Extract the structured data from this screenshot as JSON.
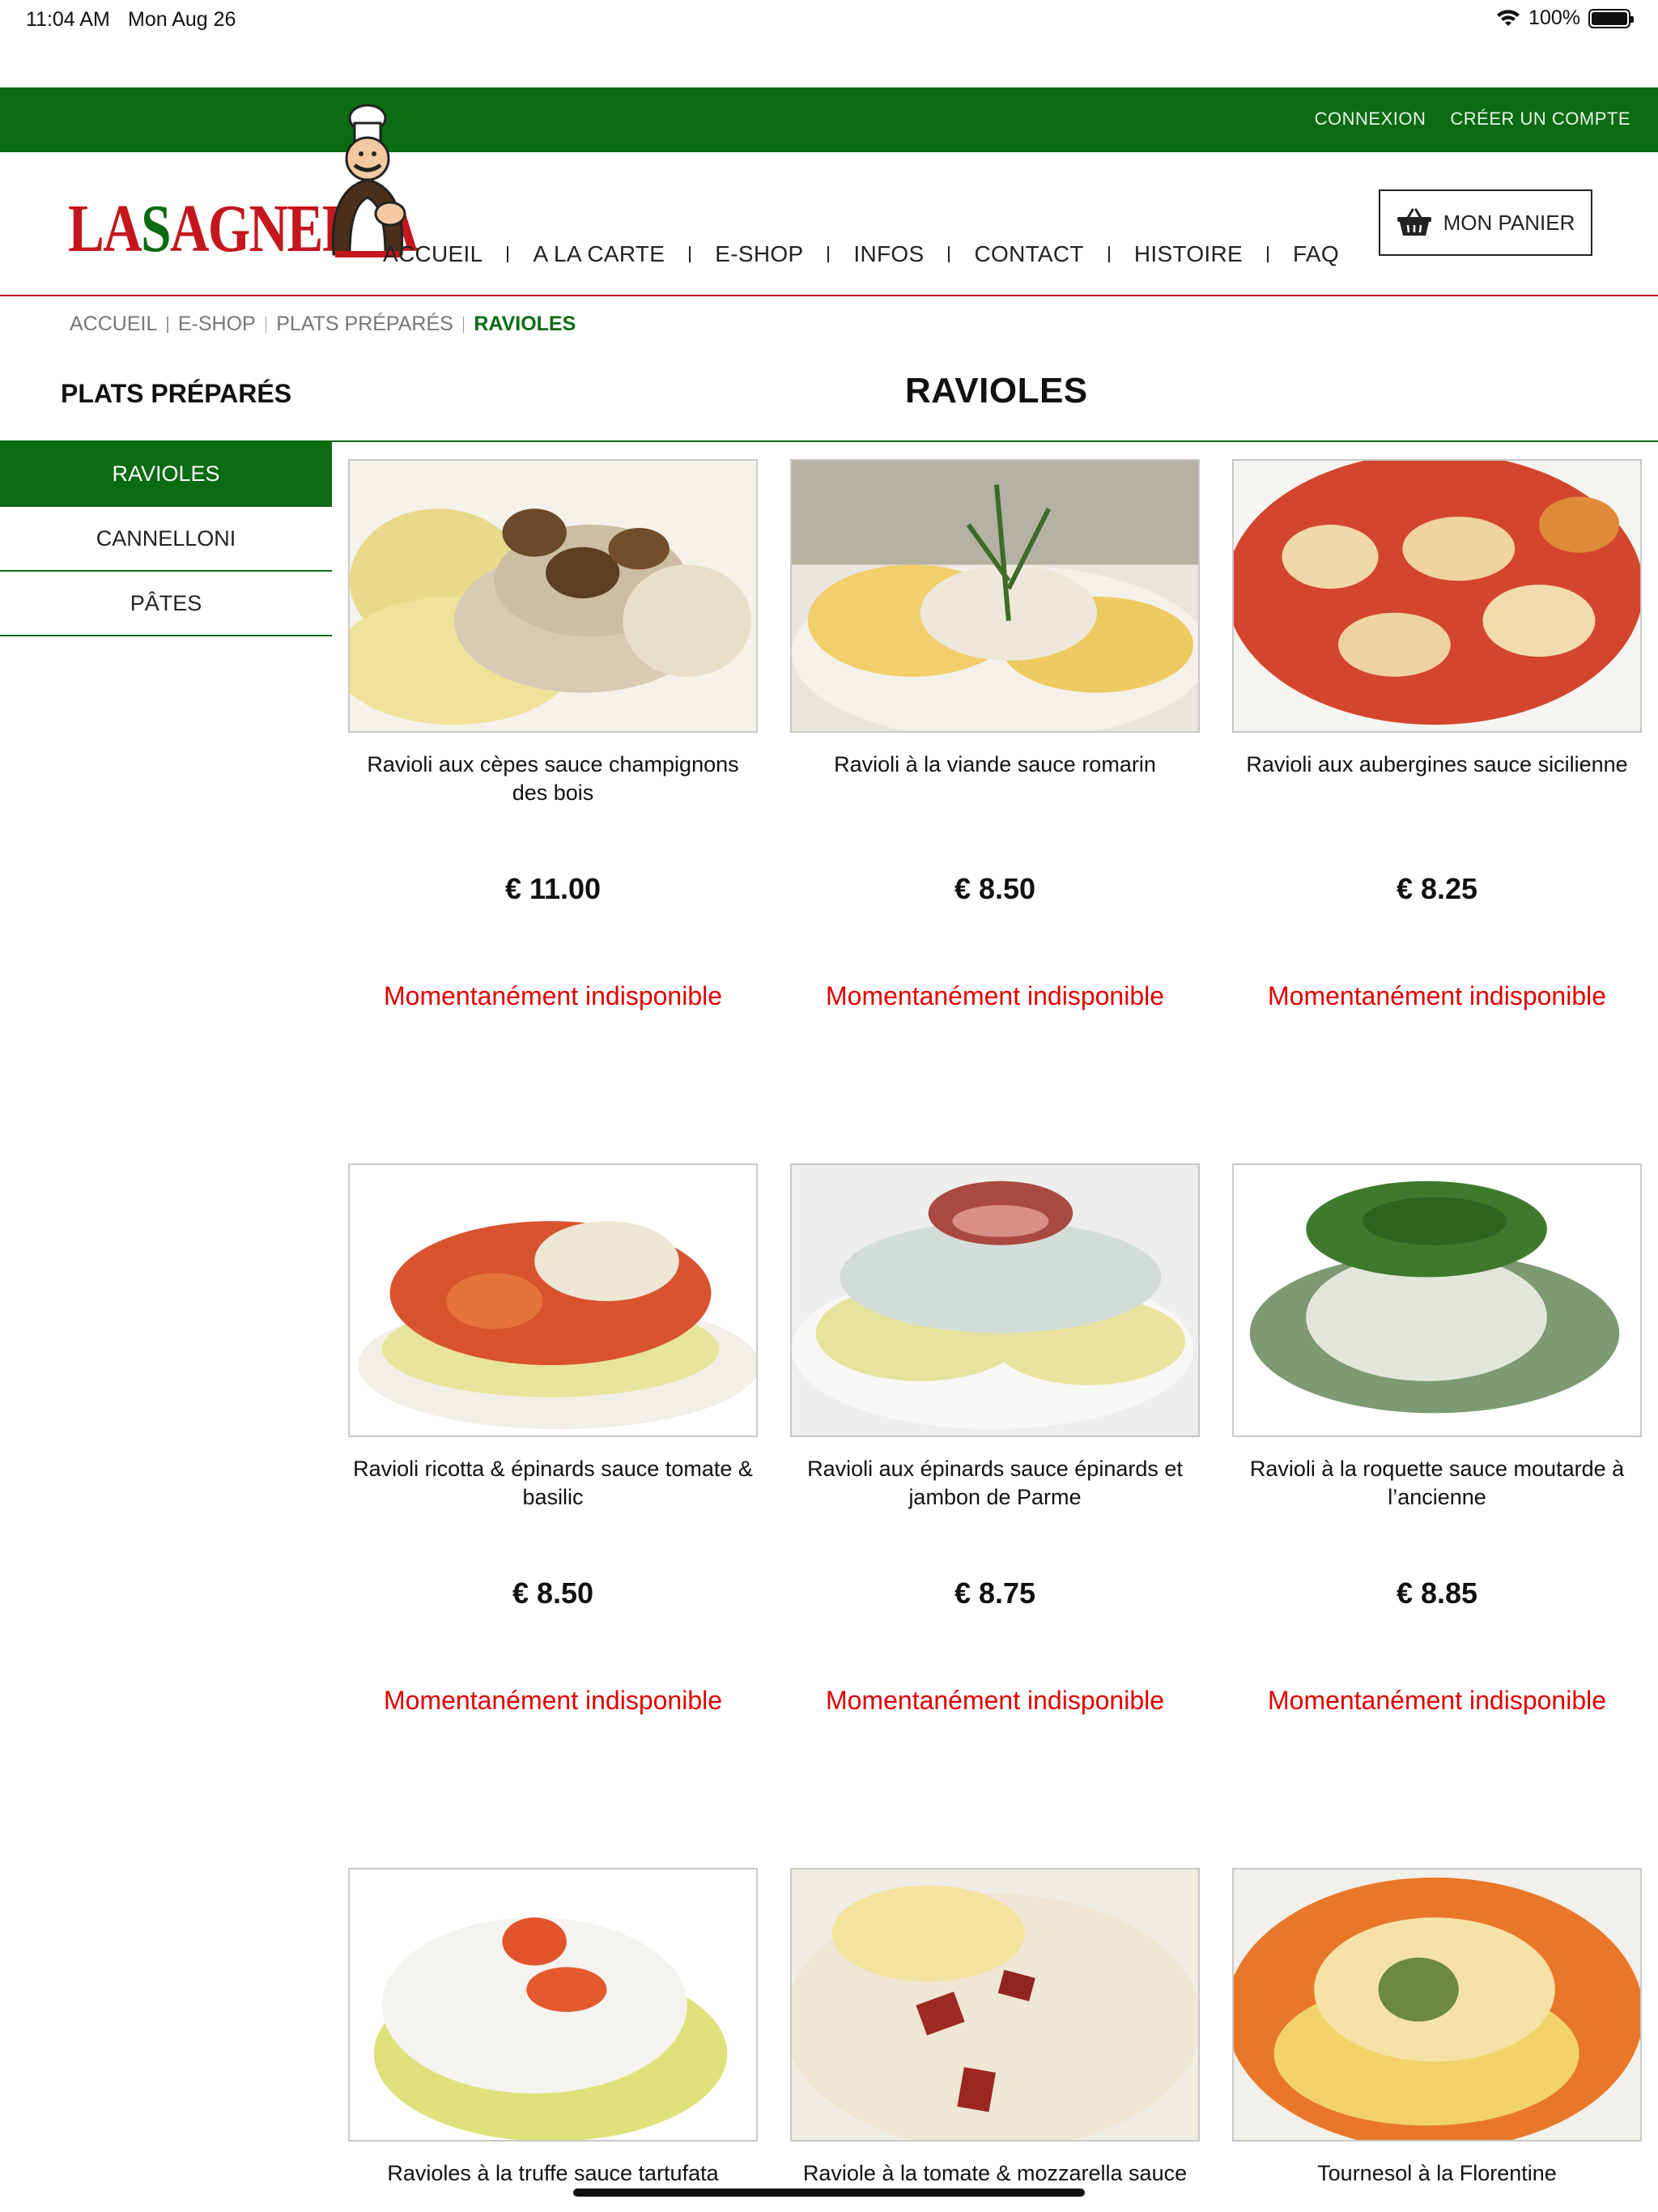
{
  "status_bar": {
    "time": "11:04 AM",
    "date": "Mon Aug 26",
    "battery": "100%"
  },
  "top_bar": {
    "login": "CONNEXION",
    "register": "CRÉER UN COMPTE",
    "color": "#0a6b12"
  },
  "logo": {
    "text_a": "LA",
    "text_s": "S",
    "text_b": "AGNERIA"
  },
  "nav": {
    "items": [
      "ACCUEIL",
      "A LA CARTE",
      "E-SHOP",
      "INFOS",
      "CONTACT",
      "HISTOIRE",
      "FAQ"
    ]
  },
  "cart": {
    "label": "MON PANIER",
    "icon": "basket-icon"
  },
  "breadcrumb": {
    "items": [
      "ACCUEIL",
      "E-SHOP",
      "PLATS PRÉPARÉS"
    ],
    "current": "RAVIOLES"
  },
  "sidebar": {
    "title": "PLATS PRÉPARÉS",
    "items": [
      {
        "label": "RAVIOLES",
        "active": true
      },
      {
        "label": "CANNELLONI",
        "active": false
      },
      {
        "label": "PÂTES",
        "active": false
      }
    ]
  },
  "main": {
    "title": "RAVIOLES"
  },
  "products": [
    {
      "name": "Ravioli aux cèpes sauce champignons des bois",
      "price": "€ 11.00",
      "status": "Momentanément indisponible"
    },
    {
      "name": "Ravioli à la viande sauce romarin",
      "price": "€ 8.50",
      "status": "Momentanément indisponible"
    },
    {
      "name": "Ravioli aux aubergines sauce sicilienne",
      "price": "€ 8.25",
      "status": "Momentanément indisponible"
    },
    {
      "name": "Ravioli ricotta & épinards sauce tomate & basilic",
      "price": "€ 8.50",
      "status": "Momentanément indisponible"
    },
    {
      "name": "Ravioli aux épinards sauce épinards et jambon de Parme",
      "price": "€ 8.75",
      "status": "Momentanément indisponible"
    },
    {
      "name": "Ravioli à la roquette sauce moutarde à l’ancienne",
      "price": "€ 8.85",
      "status": "Momentanément indisponible"
    },
    {
      "name": "Ravioles à la truffe sauce tartufata",
      "price": "",
      "status": ""
    },
    {
      "name": "Raviole à la tomate & mozzarella sauce",
      "price": "",
      "status": ""
    },
    {
      "name": "Tournesol à la Florentine",
      "price": "",
      "status": ""
    }
  ]
}
